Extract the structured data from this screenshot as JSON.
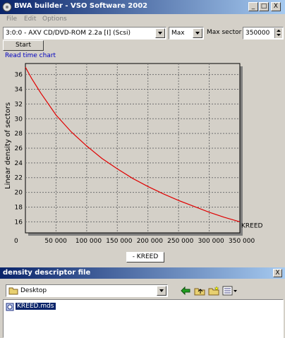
{
  "window": {
    "title": "BWA builder - VSO Software 2002",
    "minimize_glyph": "_",
    "maximize_glyph": "□",
    "close_glyph": "X"
  },
  "menu": [
    "File",
    "Edit",
    "Options"
  ],
  "toolbar": {
    "drive_value": "3:0:0 - AXV CD/DVD-ROM 2.2a [I] (Scsi)",
    "speed_value": "Max",
    "max_sector_label": "Max sector",
    "max_sector_value": "350000",
    "start_label": "Start"
  },
  "chart_section_label": "Read time chart",
  "chart_data": {
    "type": "line",
    "ylabel": "Linear density of sectors",
    "xlabel": "",
    "xlim": [
      0,
      350000
    ],
    "ylim": [
      14.5,
      37.5
    ],
    "x_ticks": [
      "0",
      "50 000",
      "100 000",
      "150 000",
      "200 000",
      "250 000",
      "300 000",
      "350 000"
    ],
    "y_ticks": [
      "36",
      "34",
      "32",
      "30",
      "28",
      "26",
      "24",
      "22",
      "20",
      "18",
      "16"
    ],
    "series": [
      {
        "name": "KREED",
        "color": "#e00000",
        "x": [
          0,
          10000,
          25000,
          50000,
          75000,
          100000,
          125000,
          150000,
          175000,
          200000,
          225000,
          250000,
          275000,
          300000,
          325000,
          350000
        ],
        "y": [
          37,
          35.5,
          33.5,
          30.5,
          28.2,
          26.3,
          24.6,
          23.2,
          21.9,
          20.8,
          19.8,
          18.9,
          18.1,
          17.3,
          16.6,
          16
        ]
      }
    ],
    "end_label": "KREED",
    "grid": true
  },
  "legend_button_label": "- KREED",
  "file_panel": {
    "title": "density descriptor file",
    "close_glyph": "X",
    "folder_value": "Desktop",
    "files": [
      "KREED.mds"
    ]
  }
}
